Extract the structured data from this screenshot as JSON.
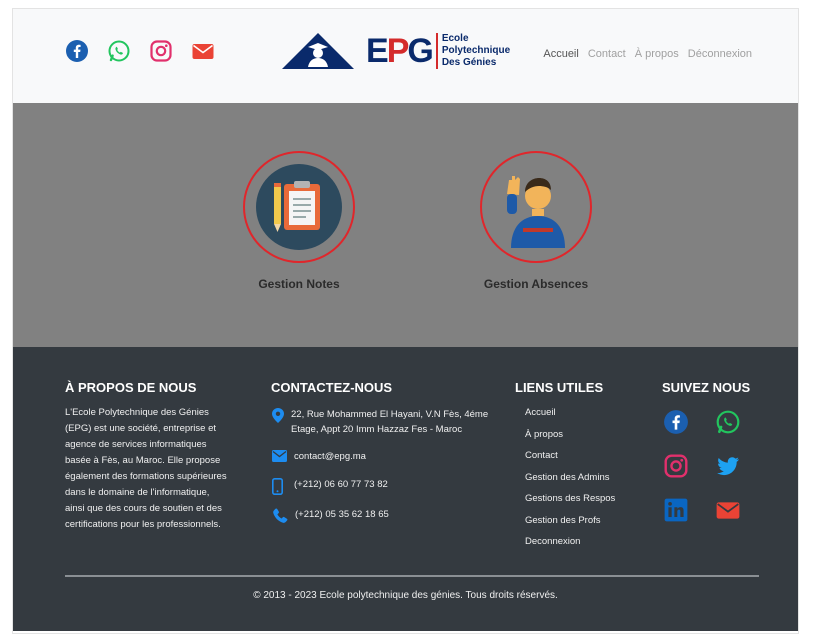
{
  "header": {
    "logo": {
      "text": "EPG",
      "line1": "Ecole",
      "line2": "Polytechnique",
      "line3": "Des Génies"
    },
    "social_icons": [
      "facebook-icon",
      "whatsapp-icon",
      "instagram-icon",
      "email-icon"
    ],
    "nav": [
      "Accueil",
      "Contact",
      "À propos",
      "Déconnexion"
    ]
  },
  "main": {
    "tiles": [
      {
        "label": "Gestion Notes",
        "icon": "clipboard-icon"
      },
      {
        "label": "Gestion Absences",
        "icon": "waving-person-icon"
      }
    ]
  },
  "footer": {
    "about": {
      "title": "À PROPOS DE NOUS",
      "text": "L'Ecole Polytechnique des Génies (EPG) est une société, entreprise et agence de services informatiques basée à Fès, au Maroc. Elle propose également des formations supérieures dans le domaine de l'informatique, ainsi que des cours de soutien et des certifications pour les professionnels."
    },
    "contact": {
      "title": "CONTACTEZ-NOUS",
      "address": "22, Rue Mohammed El Hayani, V.N Fès, 4éme Etage, Appt 20 Imm Hazzaz Fes - Maroc",
      "email": "contact@epg.ma",
      "phone1": "(+212) 06 60 77 73 82",
      "phone2": "(+212) 05 35 62 18 65"
    },
    "links": {
      "title": "LIENS UTILES",
      "items": [
        "Accueil",
        "À propos",
        "Contact",
        "Gestion des Admins",
        "Gestions des Respos",
        "Gestion des Profs",
        "Deconnexion"
      ]
    },
    "follow": {
      "title": "SUIVEZ NOUS",
      "icons": [
        "facebook-icon",
        "whatsapp-icon",
        "instagram-icon",
        "twitter-icon",
        "linkedin-icon",
        "email-icon"
      ]
    },
    "copyright": "© 2013 - 2023 Ecole polytechnique des génies. Tous droits réservés."
  },
  "colors": {
    "header_bg": "#f8f9fa",
    "main_bg": "#818181",
    "footer_bg": "#343a40",
    "accent_red": "#e0262b",
    "facebook": "#1877f2",
    "whatsapp": "#25d366",
    "instagram": "#e1306c",
    "twitter": "#1da1f2",
    "linkedin": "#0a66c2",
    "email": "#ea4335"
  }
}
